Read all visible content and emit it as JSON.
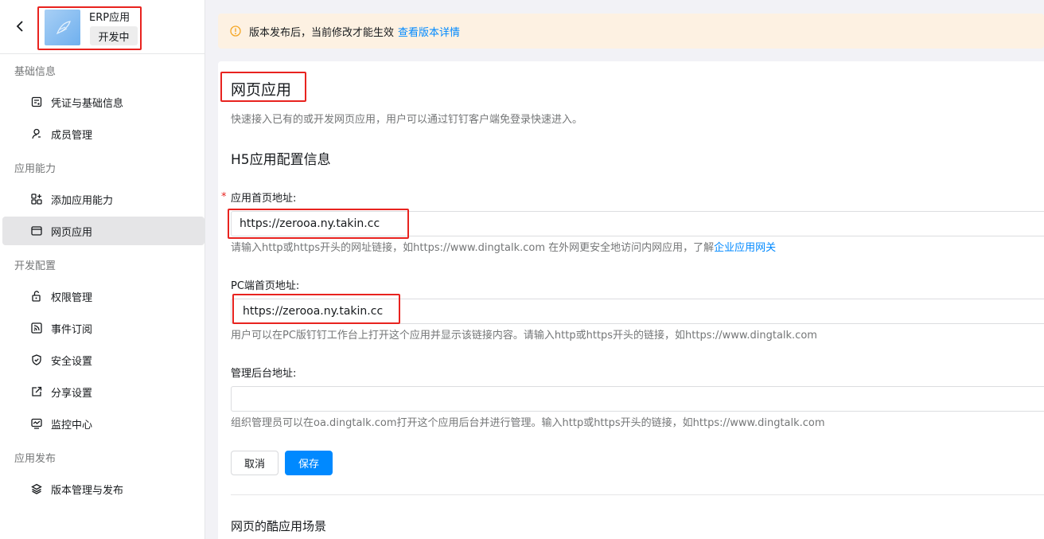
{
  "app": {
    "name": "ERP应用",
    "status": "开发中"
  },
  "sidebar": {
    "groups": [
      {
        "title": "基础信息",
        "items": [
          {
            "label": "凭证与基础信息",
            "icon": "credential-icon"
          },
          {
            "label": "成员管理",
            "icon": "user-icon"
          }
        ]
      },
      {
        "title": "应用能力",
        "items": [
          {
            "label": "添加应用能力",
            "icon": "add-capability-icon"
          },
          {
            "label": "网页应用",
            "icon": "webpage-icon",
            "active": true
          }
        ]
      },
      {
        "title": "开发配置",
        "items": [
          {
            "label": "权限管理",
            "icon": "lock-icon"
          },
          {
            "label": "事件订阅",
            "icon": "rss-icon"
          },
          {
            "label": "安全设置",
            "icon": "shield-icon"
          },
          {
            "label": "分享设置",
            "icon": "share-icon"
          },
          {
            "label": "监控中心",
            "icon": "monitor-icon"
          }
        ]
      },
      {
        "title": "应用发布",
        "items": [
          {
            "label": "版本管理与发布",
            "icon": "layers-icon"
          }
        ]
      }
    ]
  },
  "notice": {
    "text": "版本发布后，当前修改才能生效",
    "link": "查看版本详情"
  },
  "page": {
    "title": "网页应用",
    "description": "快速接入已有的或开发网页应用，用户可以通过钉钉客户端免登录快速进入。",
    "section_title": "H5应用配置信息"
  },
  "form": {
    "homepage": {
      "required_mark": "*",
      "label": "应用首页地址:",
      "value": "https://zerooa.ny.takin.cc",
      "hint": "请输入http或https开头的网址链接，如https://www.dingtalk.com 在外网更安全地访问内网应用，了解",
      "hint_link": "企业应用网关"
    },
    "pc_homepage": {
      "label": "PC端首页地址:",
      "value": "https://zerooa.ny.takin.cc",
      "hint": "用户可以在PC版钉钉工作台上打开这个应用并显示该链接内容。请输入http或https开头的链接，如https://www.dingtalk.com"
    },
    "admin_url": {
      "label": "管理后台地址:",
      "value": "",
      "hint": "组织管理员可以在oa.dingtalk.com打开这个应用后台并进行管理。输入http或https开头的链接，如https://www.dingtalk.com"
    },
    "cancel_label": "取消",
    "save_label": "保存"
  },
  "bottom": {
    "title": "网页的酷应用场景"
  },
  "colors": {
    "accent": "#0089ff",
    "highlight_box": "#e8231f",
    "notice_bg": "#fdf1e2",
    "warn": "#f5a623"
  }
}
